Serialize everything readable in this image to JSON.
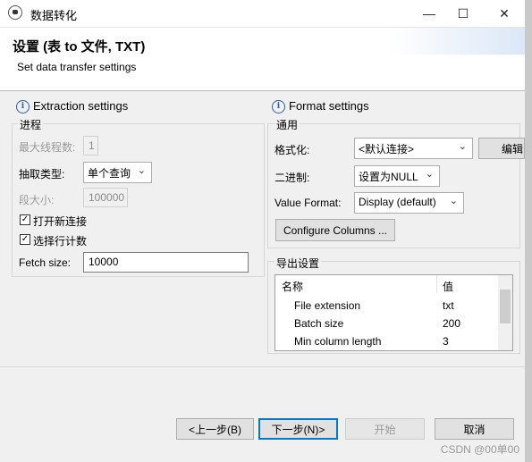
{
  "window": {
    "title": "数据转化",
    "min_glyph": "—",
    "max_glyph": "☐",
    "close_glyph": "✕"
  },
  "header": {
    "title": "设置 (表 to 文件, TXT)",
    "subtitle": "Set data transfer settings"
  },
  "extraction": {
    "title": "Extraction settings",
    "group_label": "进程",
    "max_threads": {
      "label": "最大线程数:",
      "value": "1"
    },
    "extract_type": {
      "label": "抽取类型:",
      "value": "单个查询"
    },
    "segment_size": {
      "label": "段大小:",
      "value": "100000"
    },
    "open_new_conn": {
      "label": "打开新连接",
      "checked": true,
      "mark": "✓"
    },
    "select_row_count": {
      "label": "选择行计数",
      "checked": true,
      "mark": "✓"
    },
    "fetch_size": {
      "label": "Fetch size:",
      "value": "10000"
    }
  },
  "format": {
    "title": "Format settings",
    "group_label": "通用",
    "formatting": {
      "label": "格式化:",
      "value": "<默认连接>",
      "edit_label": "编辑"
    },
    "binary": {
      "label": "二进制:",
      "value": "设置为NULL"
    },
    "value_format": {
      "label": "Value Format:",
      "value": "Display (default)"
    },
    "configure_columns": "Configure Columns ..."
  },
  "export": {
    "group_label": "导出设置",
    "columns": [
      "名称",
      "值"
    ],
    "rows": [
      {
        "name": "File extension",
        "value": "txt"
      },
      {
        "name": "Batch size",
        "value": "200"
      },
      {
        "name": "Min column length",
        "value": "3"
      }
    ]
  },
  "buttons": {
    "back": "<上一步(B)",
    "next": "下一步(N)>",
    "start": "开始",
    "cancel": "取消"
  },
  "watermark": "CSDN @00单00",
  "icons": {
    "info": "i",
    "chevron": "⌄"
  }
}
